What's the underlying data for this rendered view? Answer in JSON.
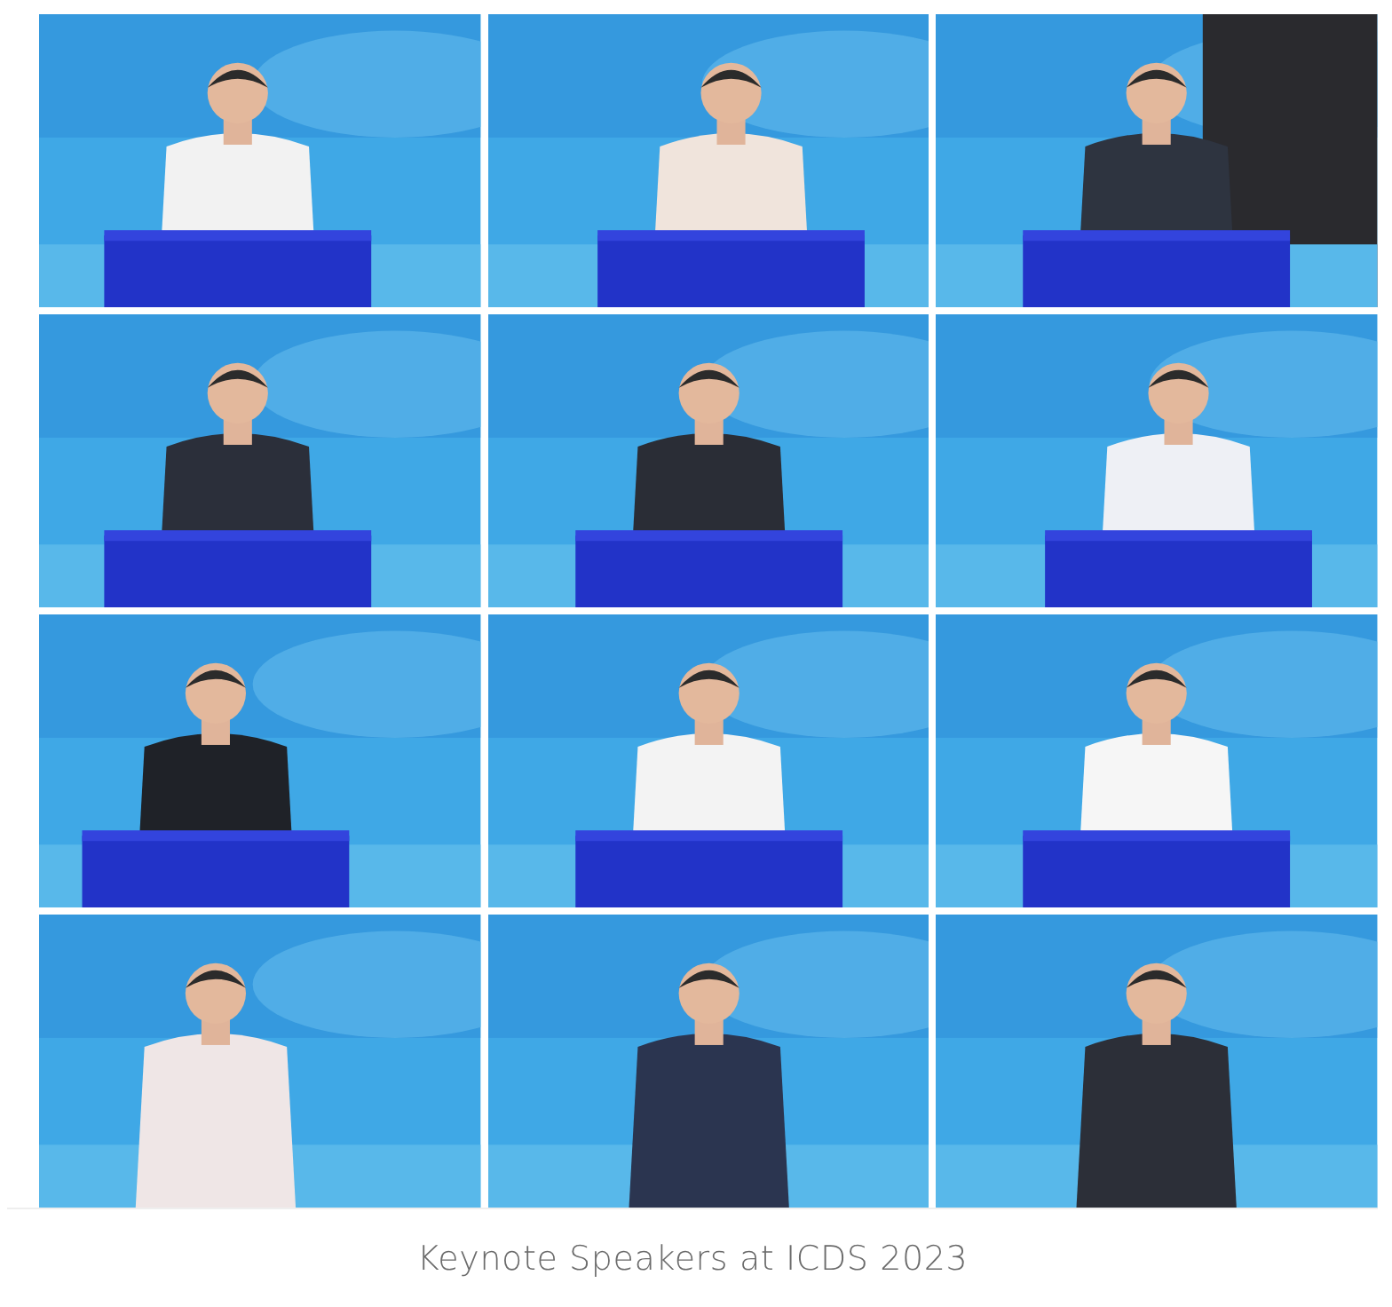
{
  "caption": "Keynote Speakers at ICDS 2023"
}
